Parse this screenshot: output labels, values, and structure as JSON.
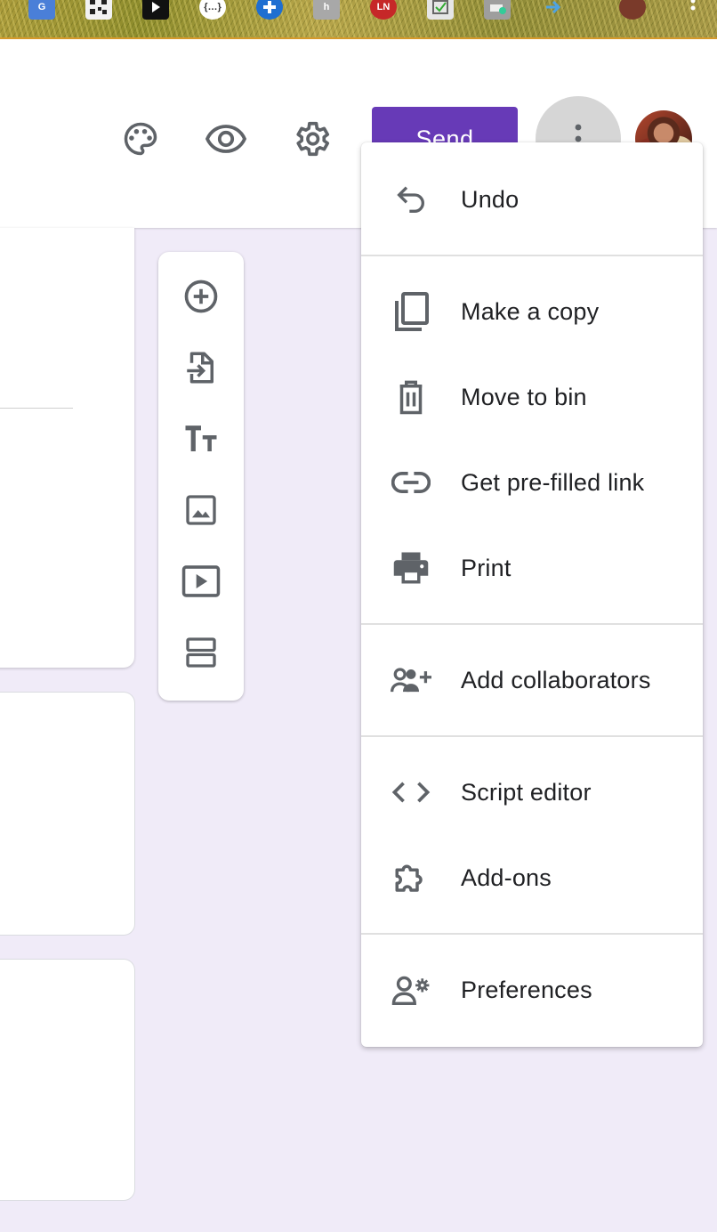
{
  "extensions": [
    {
      "name": "google-translate-extension",
      "color": "#4a7fd8"
    },
    {
      "name": "qr-code-extension",
      "color": "#2a2a2a"
    },
    {
      "name": "play-extension",
      "color": "#111111"
    },
    {
      "name": "json-viewer-extension",
      "color": "#ffffff"
    },
    {
      "name": "cross-extension",
      "color": "#1f6fd1"
    },
    {
      "name": "stylus-extension",
      "color": "#a8a8a8"
    },
    {
      "name": "ln-extension",
      "color": "#c62828"
    },
    {
      "name": "form-checker-extension",
      "color": "#d9d9d9"
    },
    {
      "name": "print-extension",
      "color": "#9e9e9e"
    },
    {
      "name": "arrow-extension",
      "color": "#4fa3e0"
    },
    {
      "name": "profile-extension",
      "color": "#7a3a2a"
    }
  ],
  "header": {
    "send_label": "Send",
    "accent": "#673ab7"
  },
  "menu": {
    "items": [
      {
        "label": "Undo",
        "icon": "undo-icon"
      },
      {
        "label": "Make a copy",
        "icon": "copy-icon"
      },
      {
        "label": "Move to bin",
        "icon": "trash-icon"
      },
      {
        "label": "Get pre-filled link",
        "icon": "link-icon"
      },
      {
        "label": "Print",
        "icon": "print-icon"
      },
      {
        "label": "Add collaborators",
        "icon": "add-people-icon"
      },
      {
        "label": "Script editor",
        "icon": "code-icon"
      },
      {
        "label": "Add-ons",
        "icon": "puzzle-icon"
      },
      {
        "label": "Preferences",
        "icon": "person-settings-icon"
      }
    ]
  },
  "toolbar": {
    "buttons": [
      "add-question-icon",
      "import-questions-icon",
      "add-title-icon",
      "add-image-icon",
      "add-video-icon",
      "add-section-icon"
    ]
  }
}
